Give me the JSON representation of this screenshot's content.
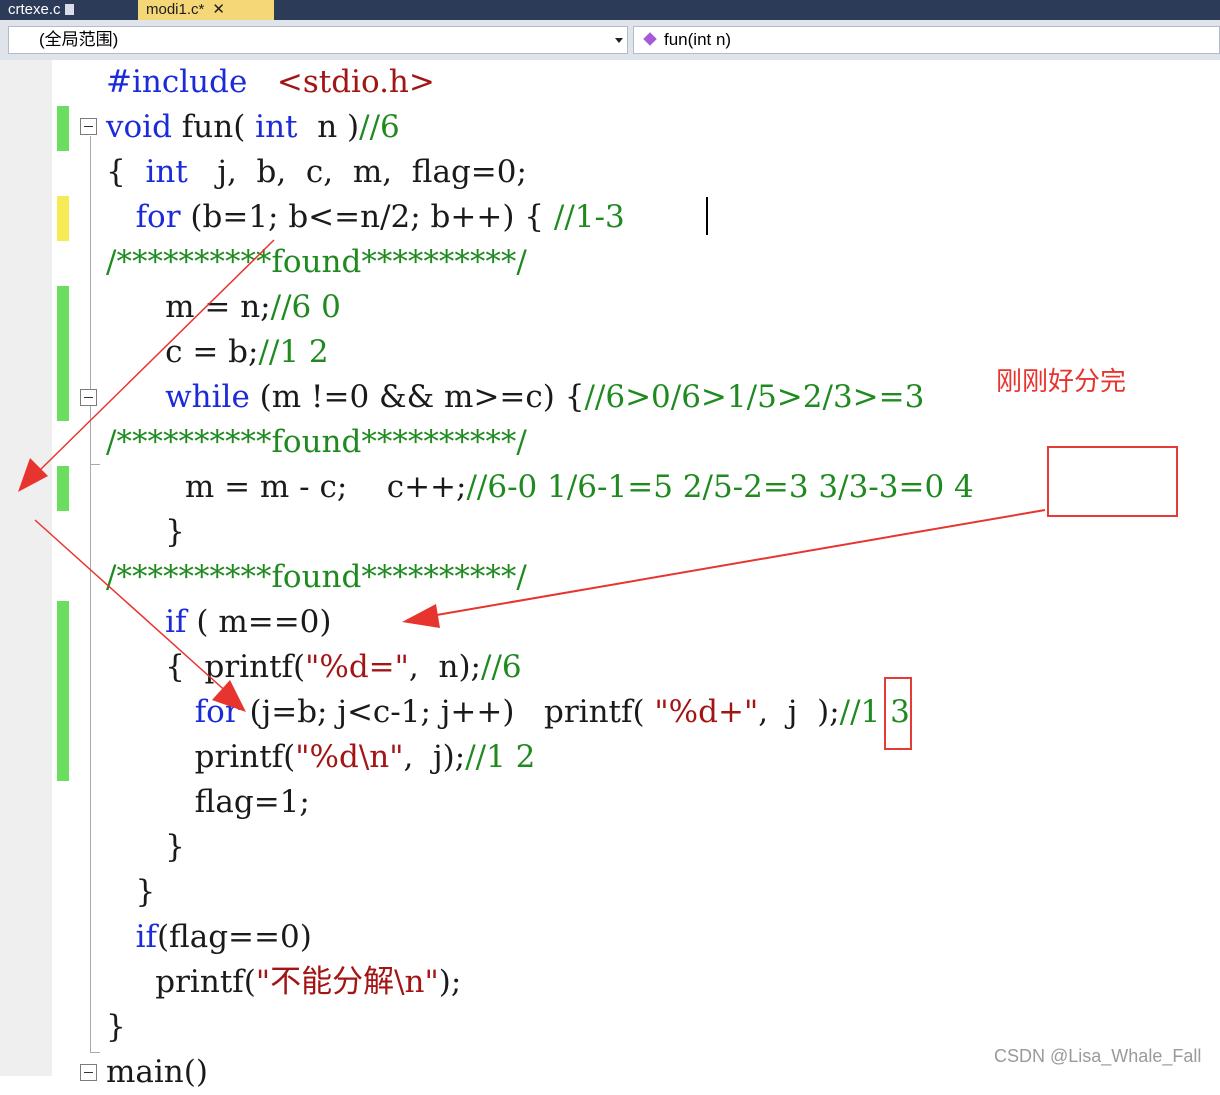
{
  "tabs": [
    {
      "label": "crtexe.c"
    },
    {
      "label": "modi1.c*",
      "close": "✕"
    }
  ],
  "nav": {
    "scope": "(全局范围)",
    "member": "fun(int n)"
  },
  "code_lines": [
    [
      [
        "kw",
        "#include"
      ],
      [
        "",
        "   "
      ],
      [
        "st",
        "<stdio.h>"
      ]
    ],
    [
      [
        "kw",
        "void"
      ],
      [
        "",
        " fun( "
      ],
      [
        "kw",
        "int"
      ],
      [
        "",
        "  n )"
      ],
      [
        "cm",
        "//6"
      ]
    ],
    [
      [
        "",
        "{  "
      ],
      [
        "kw",
        "int"
      ],
      [
        "",
        "   j,  b,  c,  m,  flag=0;"
      ]
    ],
    [
      [
        "",
        "   "
      ],
      [
        "kw",
        "for"
      ],
      [
        "",
        " (b=1; b<=n/2; b++) { "
      ],
      [
        "cm",
        "//1-3"
      ]
    ],
    [
      [
        "cm",
        "/**********found**********/"
      ]
    ],
    [
      [
        "",
        "      m = n;"
      ],
      [
        "cm",
        "//6 0"
      ]
    ],
    [
      [
        "",
        "      c = b;"
      ],
      [
        "cm",
        "//1 2"
      ]
    ],
    [
      [
        "",
        "      "
      ],
      [
        "kw",
        "while"
      ],
      [
        "",
        " (m !=0 && m>=c) {"
      ],
      [
        "cm",
        "//6>0/6>1/5>2/3>=3"
      ]
    ],
    [
      [
        "cm",
        "/**********found**********/"
      ]
    ],
    [
      [
        "",
        "        m = m - c;    c++;"
      ],
      [
        "cm",
        "//6-0 1/6-1=5 2/5-2=3 3/3-3=0 4"
      ]
    ],
    [
      [
        "",
        "      }"
      ]
    ],
    [
      [
        "cm",
        "/**********found**********/"
      ]
    ],
    [
      [
        "",
        "      "
      ],
      [
        "kw",
        "if"
      ],
      [
        "",
        " ( m==0)"
      ]
    ],
    [
      [
        "",
        "      {  printf("
      ],
      [
        "st",
        "\"%d=\""
      ],
      [
        "",
        ",  n);"
      ],
      [
        "cm",
        "//6"
      ]
    ],
    [
      [
        "",
        "         "
      ],
      [
        "kw",
        "for"
      ],
      [
        "",
        " (j=b; j<c-1; j++)   printf( "
      ],
      [
        "st",
        "\"%d+\""
      ],
      [
        "",
        ",  j  );"
      ],
      [
        "cm",
        "//1 3"
      ]
    ],
    [
      [
        "",
        "         printf("
      ],
      [
        "st",
        "\"%d\\n\""
      ],
      [
        "",
        ",  j);"
      ],
      [
        "cm",
        "//1 2"
      ]
    ],
    [
      [
        "",
        "         flag=1;"
      ]
    ],
    [
      [
        "",
        "      }"
      ]
    ],
    [
      [
        "",
        "   }"
      ]
    ],
    [
      [
        "",
        "   "
      ],
      [
        "kw",
        "if"
      ],
      [
        "",
        "(flag==0)"
      ]
    ],
    [
      [
        "",
        "     printf("
      ],
      [
        "st",
        "\"不能分解\\n\""
      ],
      [
        "",
        ");"
      ]
    ],
    [
      [
        "",
        "}"
      ]
    ],
    [
      [
        "",
        "main()"
      ]
    ]
  ],
  "annotation": "刚刚好分完",
  "watermark": "CSDN @Lisa_Whale_Fall",
  "colors": {
    "annotation_red": "#e8342e",
    "keyword_blue": "#1b2bd9",
    "comment_green": "#1f8a1f",
    "string_red": "#a31515"
  }
}
